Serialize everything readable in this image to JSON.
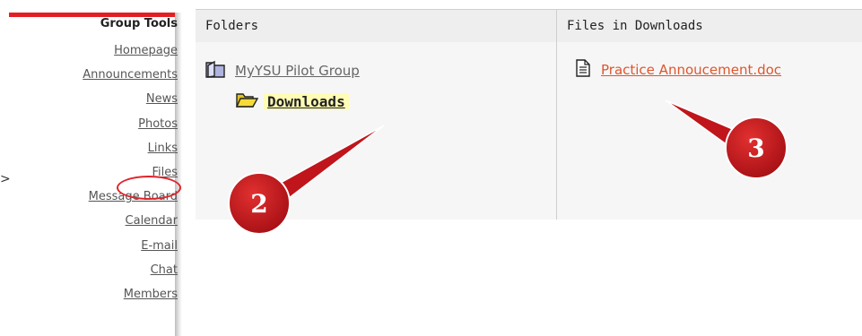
{
  "sidebar": {
    "title": "Group Tools",
    "items": [
      {
        "label": "Homepage"
      },
      {
        "label": "Announcements"
      },
      {
        "label": "News"
      },
      {
        "label": "Photos"
      },
      {
        "label": "Links"
      },
      {
        "label": "Files"
      },
      {
        "label": "Message Board"
      },
      {
        "label": "Calendar"
      },
      {
        "label": "E-mail"
      },
      {
        "label": "Chat"
      },
      {
        "label": "Members"
      }
    ],
    "highlighted_item": "Files",
    "pointer_glyph": ">"
  },
  "folders": {
    "header": "Folders",
    "group": {
      "label": "MyYSU Pilot Group"
    },
    "selected_folder": {
      "label": "Downloads"
    }
  },
  "files": {
    "header": "Files in Downloads",
    "items": [
      {
        "label": "Practice Annoucement.doc"
      }
    ]
  },
  "callouts": [
    {
      "number": "2"
    },
    {
      "number": "3"
    }
  ],
  "colors": {
    "accent_red": "#e41e24",
    "callout_red": "#c0151b",
    "link_orange": "#e0552c",
    "folder_yellow": "#f2d22a",
    "highlight_yellow": "#fffcb5"
  }
}
